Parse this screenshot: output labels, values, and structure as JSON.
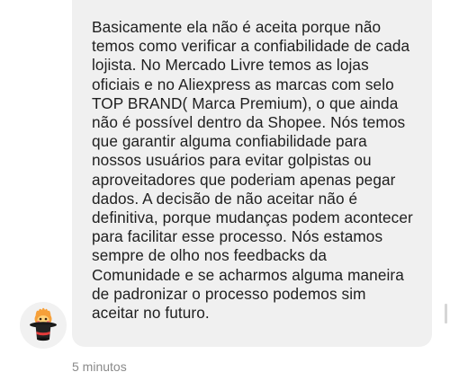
{
  "message": {
    "text": "Basicamente ela não é aceita porque não temos como verificar a confiabilidade de cada lojista. No Mercado Livre temos as lojas oficiais e no Aliexpress as marcas com selo TOP BRAND( Marca Premium), o que ainda não é possível dentro da Shopee. Nós temos que garantir alguma confiabilidade para nossos usuários para evitar golpistas ou aproveitadores que poderiam apenas pegar dados. A decisão de não aceitar não é definitiva, porque mudanças podem acontecer para facilitar esse processo. Nós estamos sempre de olho nos feedbacks da Comunidade e se acharmos alguma maneira de padronizar o processo podemos sim aceitar no futuro.",
    "timestamp": "5 minutos"
  },
  "avatar": {
    "icon": "magic-hat-icon",
    "bg_color": "#f1f1f1",
    "hat_color": "#1a1a1a",
    "creature_color": "#f6a03a"
  },
  "colors": {
    "bubble_bg": "#f0f0f0",
    "text": "#202020",
    "timestamp": "#8a8a8a"
  }
}
